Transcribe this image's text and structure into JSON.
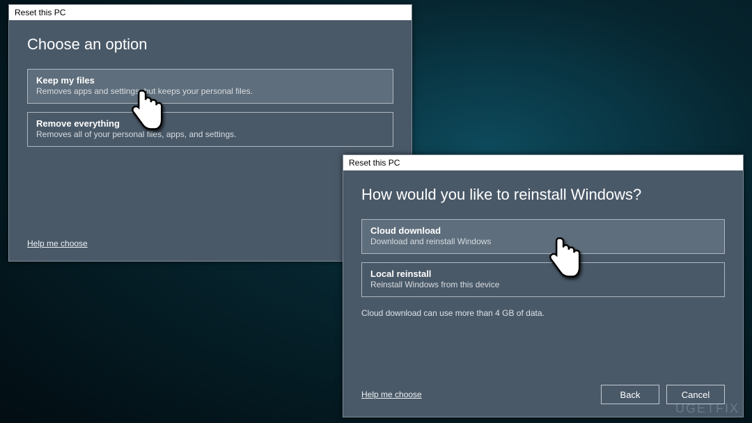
{
  "watermark": "UGETFIX",
  "dialog1": {
    "title": "Reset this PC",
    "heading": "Choose an option",
    "options": [
      {
        "title": "Keep my files",
        "desc": "Removes apps and settings, but keeps your personal files."
      },
      {
        "title": "Remove everything",
        "desc": "Removes all of your personal files, apps, and settings."
      }
    ],
    "help": "Help me choose"
  },
  "dialog2": {
    "title": "Reset this PC",
    "heading": "How would you like to reinstall Windows?",
    "options": [
      {
        "title": "Cloud download",
        "desc": "Download and reinstall Windows"
      },
      {
        "title": "Local reinstall",
        "desc": "Reinstall Windows from this device"
      }
    ],
    "note": "Cloud download can use more than 4 GB of data.",
    "help": "Help me choose",
    "back": "Back",
    "cancel": "Cancel"
  }
}
